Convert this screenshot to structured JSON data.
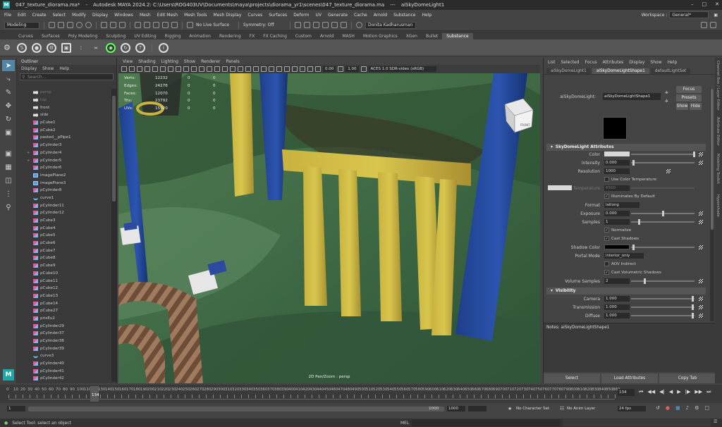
{
  "window": {
    "tab_title": "047_texture_diorama.ma*",
    "title": "Autodesk MAYA 2024.2: C:\\Users\\ROG403UV\\Documents\\maya\\projects\\diorama_yr1\\scenes\\047_texture_diorama.ma",
    "selection": "aiSkyDomeLight1",
    "logo": "M"
  },
  "menus": [
    "File",
    "Edit",
    "Create",
    "Select",
    "Modify",
    "Display",
    "Windows",
    "Mesh",
    "Edit Mesh",
    "Mesh Tools",
    "Mesh Display",
    "Curves",
    "Surfaces",
    "Deform",
    "UV",
    "Generate",
    "Cache",
    "Arnold",
    "Substance",
    "Help"
  ],
  "workspace": {
    "label": "Workspace :",
    "value": "General*"
  },
  "statusline": {
    "mode": "Modeling",
    "live_surface": "No Live Surface",
    "symmetry": "Symmetry: Off",
    "user": "Donita Kadharusman"
  },
  "shelf_tabs": [
    "Curves",
    "Surfaces",
    "Poly Modeling",
    "Sculpting",
    "UV Editing",
    "Rigging",
    "Animation",
    "Rendering",
    "FX",
    "FX Caching",
    "Custom",
    "Arnold",
    "MASH",
    "Motion Graphics",
    "XGen",
    "Bullet",
    "Substance"
  ],
  "shelf_active": "Substance",
  "outliner": {
    "title": "Outliner",
    "menu": [
      "Display",
      "Show",
      "Help"
    ],
    "search_placeholder": "Search...",
    "items": [
      {
        "name": "persp",
        "icon": "camera",
        "exp": ""
      },
      {
        "name": "top",
        "icon": "camera",
        "exp": ""
      },
      {
        "name": "front",
        "icon": "camera",
        "exp": ""
      },
      {
        "name": "side",
        "icon": "camera",
        "exp": ""
      },
      {
        "name": "pCube1",
        "icon": "mesh",
        "exp": ""
      },
      {
        "name": "pCube2",
        "icon": "mesh",
        "exp": ""
      },
      {
        "name": "pasted__pPipe1",
        "icon": "mesh",
        "exp": ""
      },
      {
        "name": "pCylinder3",
        "icon": "mesh",
        "exp": ""
      },
      {
        "name": "pCylinder4",
        "icon": "mesh",
        "exp": "+"
      },
      {
        "name": "pCylinder5",
        "icon": "mesh",
        "exp": "+"
      },
      {
        "name": "pCylinder6",
        "icon": "mesh",
        "exp": ""
      },
      {
        "name": "imagePlane2",
        "icon": "image",
        "exp": ""
      },
      {
        "name": "imagePlane3",
        "icon": "image",
        "exp": ""
      },
      {
        "name": "pCylinder8",
        "icon": "mesh",
        "exp": ""
      },
      {
        "name": "curve1",
        "icon": "curve",
        "exp": ""
      },
      {
        "name": "pCylinder11",
        "icon": "mesh",
        "exp": ""
      },
      {
        "name": "pCylinder12",
        "icon": "mesh",
        "exp": ""
      },
      {
        "name": "pCube3",
        "icon": "mesh",
        "exp": ""
      },
      {
        "name": "pCube4",
        "icon": "mesh",
        "exp": ""
      },
      {
        "name": "pCube5",
        "icon": "mesh",
        "exp": ""
      },
      {
        "name": "pCube6",
        "icon": "mesh",
        "exp": ""
      },
      {
        "name": "pCube7",
        "icon": "mesh",
        "exp": ""
      },
      {
        "name": "pCube8",
        "icon": "mesh",
        "exp": ""
      },
      {
        "name": "pCube9",
        "icon": "mesh",
        "exp": ""
      },
      {
        "name": "pCube10",
        "icon": "mesh",
        "exp": ""
      },
      {
        "name": "pCube11",
        "icon": "mesh",
        "exp": ""
      },
      {
        "name": "pCube12",
        "icon": "mesh",
        "exp": ""
      },
      {
        "name": "pCube13",
        "icon": "mesh",
        "exp": ""
      },
      {
        "name": "pCube14",
        "icon": "mesh",
        "exp": ""
      },
      {
        "name": "pCube27",
        "icon": "mesh",
        "exp": ""
      },
      {
        "name": "prisEu2",
        "icon": "mesh",
        "exp": ""
      },
      {
        "name": "pCylinder29",
        "icon": "mesh",
        "exp": ""
      },
      {
        "name": "pCylinder37",
        "icon": "mesh",
        "exp": ""
      },
      {
        "name": "pCylinder38",
        "icon": "mesh",
        "exp": ""
      },
      {
        "name": "pCylinder39",
        "icon": "mesh",
        "exp": ""
      },
      {
        "name": "curve3",
        "icon": "curve",
        "exp": ""
      },
      {
        "name": "pCylinder40",
        "icon": "mesh",
        "exp": ""
      },
      {
        "name": "pCylinder41",
        "icon": "mesh",
        "exp": ""
      },
      {
        "name": "pCylinder42",
        "icon": "mesh",
        "exp": ""
      }
    ]
  },
  "viewport": {
    "menu": [
      "View",
      "Shading",
      "Lighting",
      "Show",
      "Renderer",
      "Panels"
    ],
    "exposure": "0.00",
    "gamma": "1.00",
    "color_space": "ACES 1.0 SDR-video (sRGB)",
    "hud": [
      {
        "label": "Verts:",
        "a": "12232",
        "b": "0",
        "c": "0"
      },
      {
        "label": "Edges:",
        "a": "24276",
        "b": "0",
        "c": "0"
      },
      {
        "label": "Faces:",
        "a": "12070",
        "b": "0",
        "c": "0"
      },
      {
        "label": "Tris:",
        "a": "23792",
        "b": "0",
        "c": "0"
      },
      {
        "label": "UVs:",
        "a": "15920",
        "b": "0",
        "c": "0"
      }
    ],
    "caption": "2D Pan/Zoom : persp",
    "viewcube": "FRONT"
  },
  "attr": {
    "menu": [
      "List",
      "Selected",
      "Focus",
      "Attributes",
      "Display",
      "Show",
      "Help"
    ],
    "tabs": [
      "aiSkyDomeLight1",
      "aiSkyDomeLightShape1",
      "defaultLightSet"
    ],
    "active_tab": "aiSkyDomeLightShape1",
    "node_label": "aiSkyDomeLight:",
    "node_value": "aiSkyDomeLightShape1",
    "buttons": {
      "focus": "Focus",
      "presets": "Presets",
      "show": "Show",
      "hide": "Hide"
    },
    "section1": "SkyDomeLight Attributes",
    "rows": {
      "color": "Color",
      "intensity": {
        "label": "Intensity",
        "value": "0.000"
      },
      "resolution": {
        "label": "Resolution",
        "value": "1000"
      },
      "use_color_temp": "Use Color Temperature",
      "temperature": {
        "label": "Temperature",
        "value": "6500"
      },
      "illuminates": "Illuminates By Default",
      "format": {
        "label": "Format",
        "value": "latlong"
      },
      "exposure": {
        "label": "Exposure",
        "value": "0.000"
      },
      "samples": {
        "label": "Samples",
        "value": "1"
      },
      "normalize": "Normalize",
      "cast_shadows": "Cast Shadows",
      "shadow_color": "Shadow Color",
      "portal_mode": {
        "label": "Portal Mode",
        "value": "interior_only"
      },
      "aov_indirect": "AOV Indirect",
      "cast_vol": "Cast Volumetric Shadows",
      "volume_samples": {
        "label": "Volume Samples",
        "value": "2"
      }
    },
    "section2": "Visibility",
    "visibility": [
      {
        "label": "Camera",
        "value": "1.000"
      },
      {
        "label": "Transmission",
        "value": "1.000"
      },
      {
        "label": "Diffuse",
        "value": "1.000"
      }
    ],
    "notes": "Notes: aiSkyDomeLightShape1",
    "bottom_buttons": [
      "Select",
      "Load Attributes",
      "Copy Tab"
    ]
  },
  "side_tabs": [
    "Channel Box / Layer Editor",
    "Attribute Editor",
    "Modeling Toolkit",
    "Hypershade"
  ],
  "timeline": {
    "ticks": [
      "0",
      "10",
      "20",
      "30",
      "40",
      "50",
      "60",
      "70",
      "80",
      "90",
      "100",
      "110",
      "120",
      "130",
      "140",
      "150",
      "160",
      "170",
      "180",
      "190",
      "200",
      "210",
      "220",
      "230",
      "240",
      "250",
      "260",
      "270",
      "280",
      "290",
      "300",
      "310",
      "320",
      "330",
      "340",
      "350",
      "360",
      "370",
      "380",
      "390",
      "400",
      "410",
      "420",
      "430",
      "440",
      "450",
      "460",
      "470",
      "480",
      "490",
      "500",
      "510",
      "520",
      "530",
      "540",
      "550",
      "560",
      "570",
      "580",
      "590",
      "600",
      "610",
      "620",
      "630",
      "640",
      "650",
      "660",
      "670",
      "680",
      "690",
      "700",
      "710",
      "720",
      "730",
      "740",
      "750",
      "760",
      "770",
      "780",
      "790",
      "800",
      "810",
      "820",
      "830",
      "840",
      "850",
      "860",
      "870",
      "880",
      "890",
      "900",
      "910",
      "920",
      "930",
      "940",
      "950",
      "960",
      "970",
      "980",
      "990",
      "1000"
    ],
    "current_frame": "134",
    "current_frame_field": "134"
  },
  "range": {
    "start": "1",
    "inner_start": "1",
    "inner_end": "1000",
    "end": "1000",
    "character_set": "No Character Set",
    "anim_layer": "No Anim Layer",
    "fps": "24 fps"
  },
  "help": {
    "text": "Select Tool: select an object",
    "mel": "MEL"
  },
  "colors": {
    "accent": "#5285a6",
    "teal": "#1fa7a8"
  }
}
